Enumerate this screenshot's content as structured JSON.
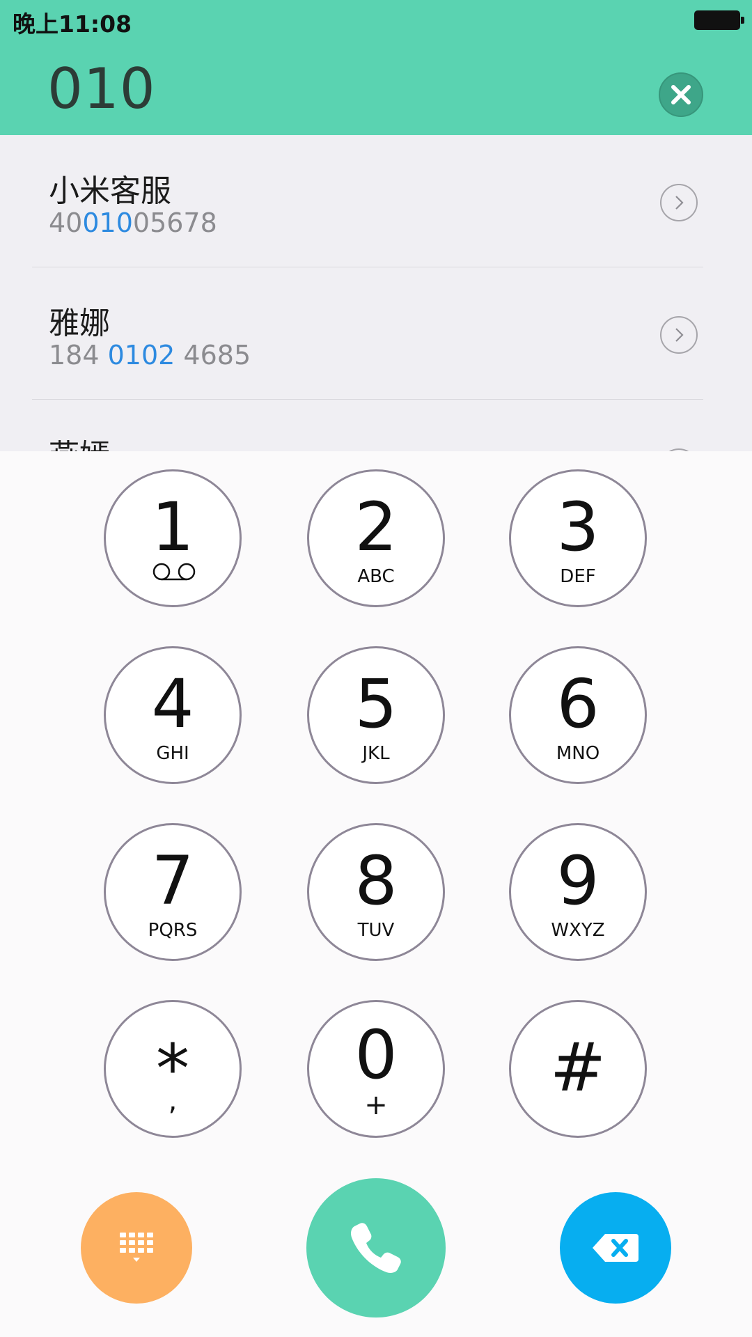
{
  "status_bar": {
    "time": "晚上11:08",
    "battery_icon": "battery-full-icon"
  },
  "header": {
    "dialed_number": "010",
    "clear_icon": "clear-icon",
    "accent_color": "#5ad3b1"
  },
  "contacts": [
    {
      "name": "小米客服",
      "number_parts": [
        "40",
        "010",
        "05678"
      ]
    },
    {
      "name": "雅娜",
      "number_parts": [
        "184 ",
        "0102",
        " 4685"
      ]
    },
    {
      "name": "燕嫣",
      "number_parts": [
        "",
        "",
        ""
      ]
    }
  ],
  "keypad": {
    "keys": [
      {
        "digit": "1",
        "letters": "",
        "icon": "voicemail-icon"
      },
      {
        "digit": "2",
        "letters": "ABC"
      },
      {
        "digit": "3",
        "letters": "DEF"
      },
      {
        "digit": "4",
        "letters": "GHI"
      },
      {
        "digit": "5",
        "letters": "JKL"
      },
      {
        "digit": "6",
        "letters": "MNO"
      },
      {
        "digit": "7",
        "letters": "PQRS"
      },
      {
        "digit": "8",
        "letters": "TUV"
      },
      {
        "digit": "9",
        "letters": "WXYZ"
      },
      {
        "digit": "*",
        "sub": ","
      },
      {
        "digit": "0",
        "sub": "+"
      },
      {
        "digit": "#",
        "sub": ""
      }
    ]
  },
  "actions": {
    "dialpad_icon": "dialpad-icon",
    "call_icon": "phone-icon",
    "backspace_icon": "backspace-icon",
    "dialpad_color": "#fdb061",
    "call_color": "#5ad3b1",
    "backspace_color": "#07aef0"
  }
}
